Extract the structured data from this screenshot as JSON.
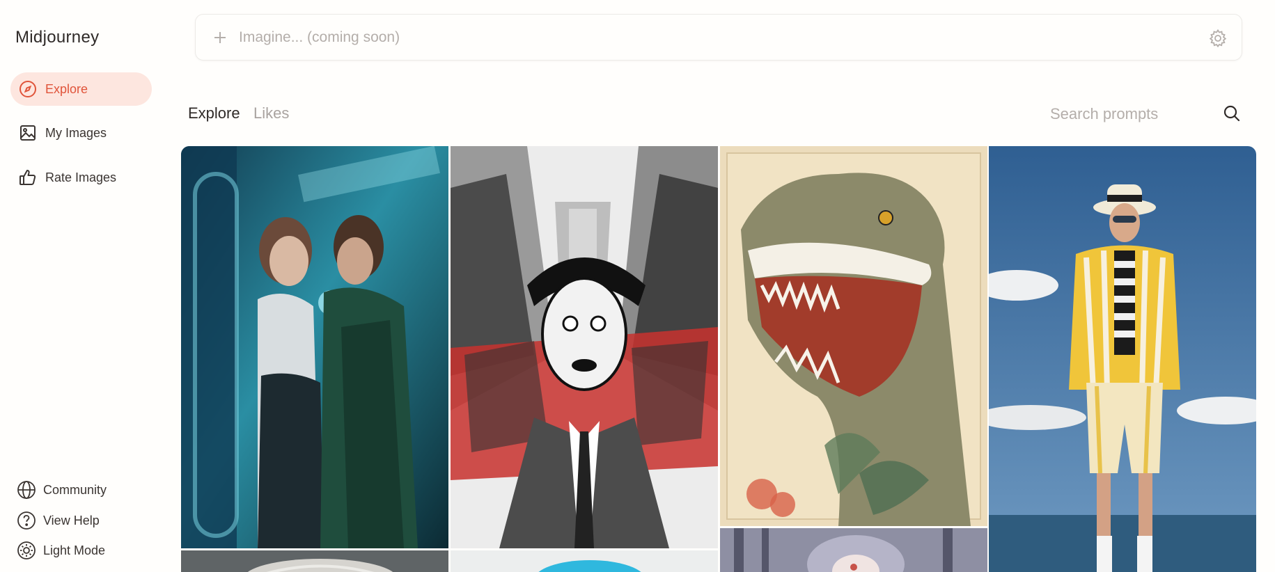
{
  "app": {
    "brand": "Midjourney"
  },
  "sidebar": {
    "items": [
      {
        "label": "Explore",
        "icon": "compass-icon",
        "active": true
      },
      {
        "label": "My Images",
        "icon": "image-icon",
        "active": false
      },
      {
        "label": "Rate Images",
        "icon": "thumbs-up-icon",
        "active": false
      }
    ],
    "bottom": [
      {
        "label": "Community",
        "icon": "globe-icon"
      },
      {
        "label": "View Help",
        "icon": "help-circle-icon"
      },
      {
        "label": "Light Mode",
        "icon": "sun-icon"
      }
    ]
  },
  "prompt": {
    "placeholder": "Imagine... (coming soon)"
  },
  "tabs": [
    {
      "label": "Explore",
      "active": true
    },
    {
      "label": "Likes",
      "active": false
    }
  ],
  "search": {
    "placeholder": "Search prompts"
  },
  "gallery": {
    "images": [
      {
        "subject": "two women on a subway train, teal and blue painting"
      },
      {
        "subject": "black white and red comic illustration of screaming man among skyscrapers"
      },
      {
        "subject": "vintage illustration of a roaring t-rex with flowers"
      },
      {
        "subject": "man in yellow striped suit and hat standing by the sea"
      },
      {
        "subject": "grey curly hair bust"
      },
      {
        "subject": "bright blue hair"
      },
      {
        "subject": "illustration with trees and pale figure"
      }
    ]
  },
  "colors": {
    "accent": "#e0543a",
    "accent_bg": "#fde6df",
    "background": "#fffefc"
  }
}
